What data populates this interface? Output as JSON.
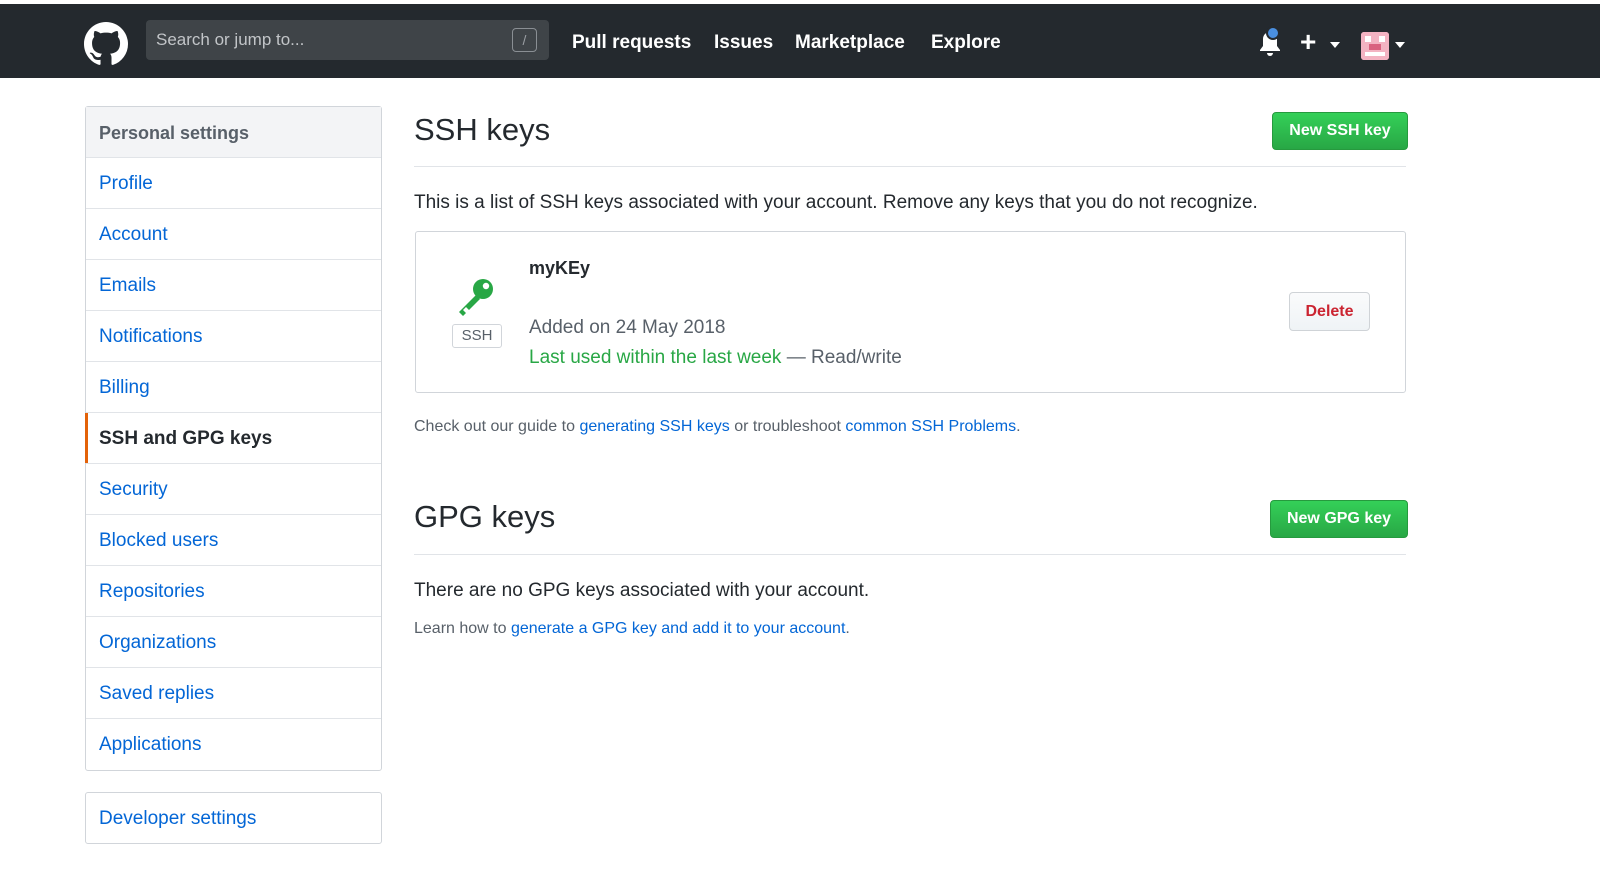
{
  "header": {
    "search_placeholder": "Search or jump to...",
    "search_shortcut": "/",
    "nav": [
      "Pull requests",
      "Issues",
      "Marketplace",
      "Explore"
    ],
    "plus_label": "+",
    "icons": [
      "github-logo-icon",
      "bell-icon",
      "plus-icon",
      "avatar"
    ]
  },
  "sidebar": {
    "title": "Personal settings",
    "items": [
      {
        "label": "Profile"
      },
      {
        "label": "Account"
      },
      {
        "label": "Emails"
      },
      {
        "label": "Notifications"
      },
      {
        "label": "Billing"
      },
      {
        "label": "SSH and GPG keys",
        "active": true
      },
      {
        "label": "Security"
      },
      {
        "label": "Blocked users"
      },
      {
        "label": "Repositories"
      },
      {
        "label": "Organizations"
      },
      {
        "label": "Saved replies"
      },
      {
        "label": "Applications"
      }
    ],
    "developer_settings": "Developer settings"
  },
  "ssh": {
    "title": "SSH keys",
    "new_button": "New SSH key",
    "description": "This is a list of SSH keys associated with your account. Remove any keys that you do not recognize.",
    "key": {
      "badge": "SSH",
      "name": "myKEy",
      "added": "Added on 24 May 2018",
      "last_used": "Last used within the last week",
      "access": " — Read/write",
      "delete_button": "Delete"
    },
    "guide_prefix": "Check out our guide to ",
    "guide_link1": "generating SSH keys",
    "guide_middle": " or troubleshoot ",
    "guide_link2": "common SSH Problems",
    "guide_suffix": "."
  },
  "gpg": {
    "title": "GPG keys",
    "new_button": "New GPG key",
    "empty_text": "There are no GPG keys associated with your account.",
    "learn_prefix": "Learn how to ",
    "learn_link": "generate a GPG key and add it to your account",
    "learn_suffix": "."
  },
  "colors": {
    "header_bg": "#24292e",
    "link": "#0366d6",
    "green": "#28a745",
    "danger": "#cb2431",
    "active_marker": "#e36209"
  }
}
